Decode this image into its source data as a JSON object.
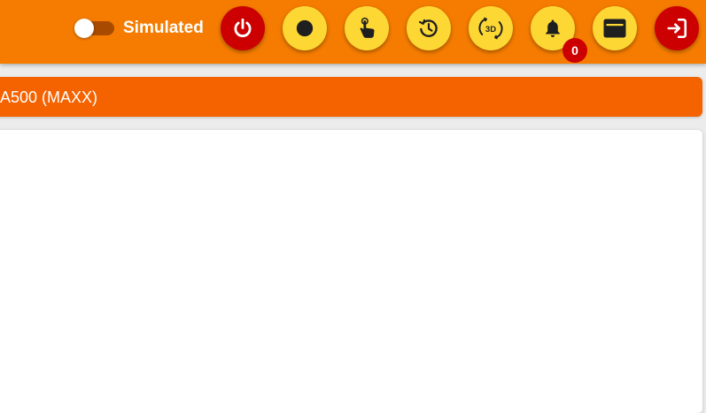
{
  "topbar": {
    "simulation_toggle": {
      "label": "Simulated",
      "on": false
    },
    "buttons": [
      {
        "id": "power",
        "icon": "power-icon",
        "color": "#cc0000"
      },
      {
        "id": "record",
        "icon": "record-dot-icon",
        "color": "#fdd835"
      },
      {
        "id": "touch",
        "icon": "touch-hand-icon",
        "color": "#fdd835"
      },
      {
        "id": "history",
        "icon": "history-icon",
        "color": "#fdd835"
      },
      {
        "id": "view-3d",
        "icon": "rotate-3d-icon",
        "label": "3D",
        "color": "#fdd835"
      },
      {
        "id": "notifications",
        "icon": "bell-icon",
        "color": "#fdd835"
      },
      {
        "id": "window",
        "icon": "window-icon",
        "color": "#fdd835"
      },
      {
        "id": "logout",
        "icon": "exit-icon",
        "color": "#cc0000"
      }
    ],
    "notification_count": "0"
  },
  "machine_title": "A500 (MAXX)",
  "colors": {
    "topbar": "#f57c00",
    "title_bar": "#f46300",
    "accent_red": "#cc0000",
    "accent_yellow": "#fdd835",
    "icon_dark": "#1f1f1f"
  }
}
